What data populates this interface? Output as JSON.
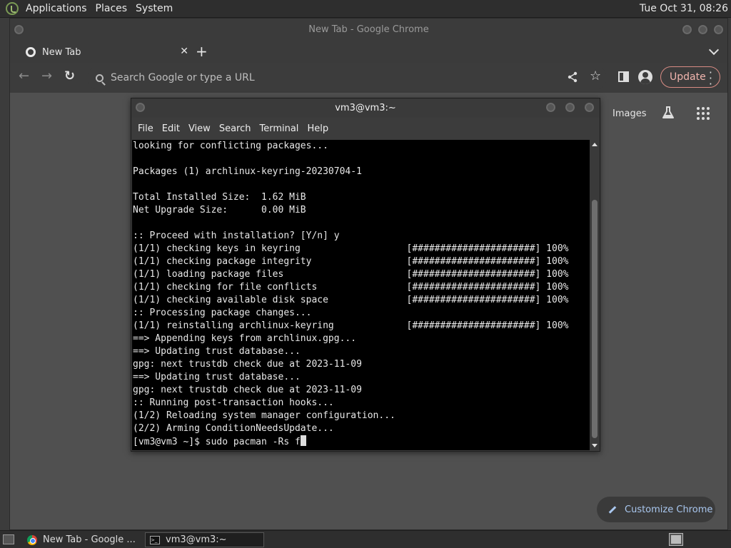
{
  "top_panel": {
    "menus": [
      "Applications",
      "Places",
      "System"
    ],
    "clock": "Tue Oct 31, 08:26"
  },
  "chrome": {
    "window_title": "New Tab - Google Chrome",
    "tab_title": "New Tab",
    "tab_close": "✕",
    "new_tab": "+",
    "omnibox_placeholder": "Search Google or type a URL",
    "update_label": "Update",
    "page_links": {
      "images": "Images"
    },
    "customize_label": "Customize Chrome"
  },
  "terminal": {
    "title": "vm3@vm3:~",
    "menus": [
      "File",
      "Edit",
      "View",
      "Search",
      "Terminal",
      "Help"
    ],
    "lines": [
      "looking for conflicting packages...",
      "",
      "Packages (1) archlinux-keyring-20230704-1",
      "",
      "Total Installed Size:  1.62 MiB",
      "Net Upgrade Size:      0.00 MiB",
      "",
      ":: Proceed with installation? [Y/n] y",
      "(1/1) checking keys in keyring                   [######################] 100%",
      "(1/1) checking package integrity                 [######################] 100%",
      "(1/1) loading package files                      [######################] 100%",
      "(1/1) checking for file conflicts                [######################] 100%",
      "(1/1) checking available disk space              [######################] 100%",
      ":: Processing package changes...",
      "(1/1) reinstalling archlinux-keyring             [######################] 100%",
      "==> Appending keys from archlinux.gpg...",
      "==> Updating trust database...",
      "gpg: next trustdb check due at 2023-11-09",
      "==> Updating trust database...",
      "gpg: next trustdb check due at 2023-11-09",
      ":: Running post-transaction hooks...",
      "(1/2) Reloading system manager configuration...",
      "(2/2) Arming ConditionNeedsUpdate..."
    ],
    "prompt_line": "[vm3@vm3 ~]$ sudo pacman -Rs f"
  },
  "taskbar": {
    "tasks": [
      "New Tab - Google ...",
      "vm3@vm3:~"
    ]
  }
}
